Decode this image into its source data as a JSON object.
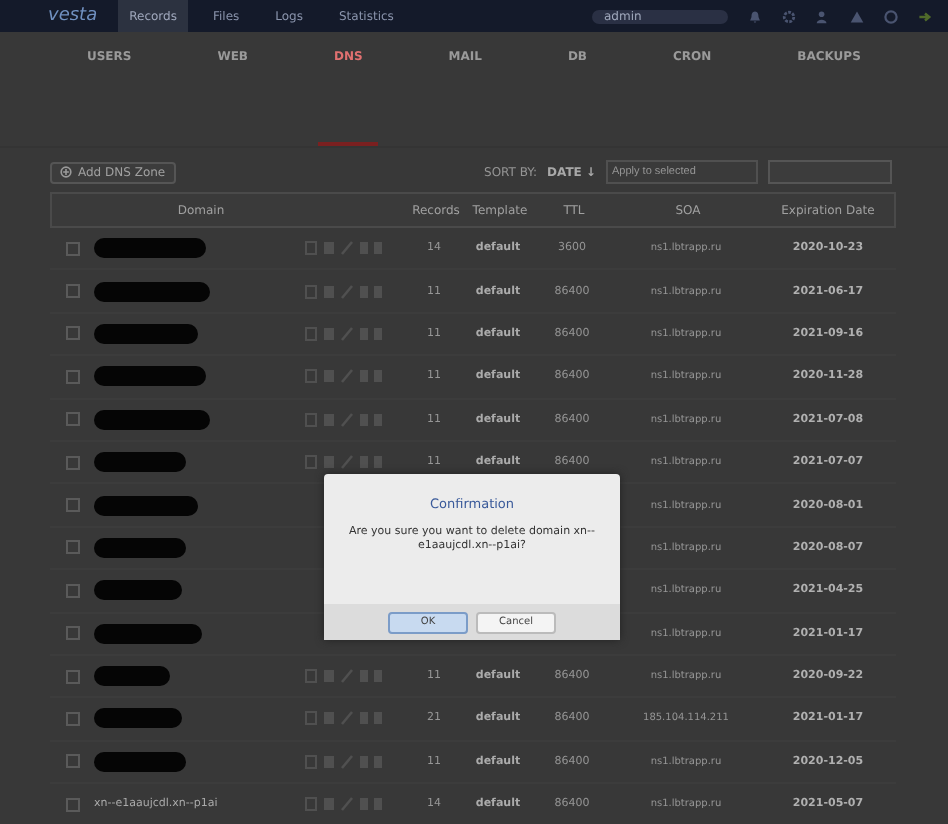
{
  "topbar": {
    "logo": "vesta",
    "nav": [
      {
        "label": "Records",
        "selected": true
      },
      {
        "label": "Files",
        "selected": false
      },
      {
        "label": "Logs",
        "selected": false
      },
      {
        "label": "Statistics",
        "selected": false
      }
    ],
    "user": "admin"
  },
  "sections": [
    {
      "label": "USERS",
      "selected": false
    },
    {
      "label": "WEB",
      "selected": false
    },
    {
      "label": "DNS",
      "selected": true
    },
    {
      "label": "MAIL",
      "selected": false
    },
    {
      "label": "DB",
      "selected": false
    },
    {
      "label": "CRON",
      "selected": false
    },
    {
      "label": "BACKUPS",
      "selected": false
    }
  ],
  "toolbar": {
    "add_button": "Add DNS Zone",
    "sort_label": "SORT BY:",
    "sort_value": "DATE ↓",
    "bulk_placeholder": "Apply to selected"
  },
  "table": {
    "columns": [
      "Domain",
      "Records",
      "Template",
      "TTL",
      "SOA",
      "Expiration Date"
    ],
    "rows": [
      {
        "checked": false,
        "records": "14",
        "template": "default",
        "ttl": "3600",
        "soa": "ns1.lbtrapp.ru",
        "date": "2020-10-23"
      },
      {
        "checked": false,
        "records": "11",
        "template": "default",
        "ttl": "86400",
        "soa": "ns1.lbtrapp.ru",
        "date": "2021-06-17"
      },
      {
        "checked": false,
        "records": "11",
        "template": "default",
        "ttl": "86400",
        "soa": "ns1.lbtrapp.ru",
        "date": "2021-09-16"
      },
      {
        "checked": false,
        "records": "11",
        "template": "default",
        "ttl": "86400",
        "soa": "ns1.lbtrapp.ru",
        "date": "2020-11-28"
      },
      {
        "checked": false,
        "records": "11",
        "template": "default",
        "ttl": "86400",
        "soa": "ns1.lbtrapp.ru",
        "date": "2021-07-08"
      },
      {
        "checked": false,
        "records": "11",
        "template": "default",
        "ttl": "86400",
        "soa": "ns1.lbtrapp.ru",
        "date": "2021-07-07"
      },
      {
        "checked": false,
        "soa": "ns1.lbtrapp.ru",
        "date": "2020-08-01"
      },
      {
        "checked": false,
        "soa": "ns1.lbtrapp.ru",
        "date": "2020-08-07"
      },
      {
        "checked": false,
        "soa": "ns1.lbtrapp.ru",
        "date": "2021-04-25"
      },
      {
        "checked": false,
        "soa": "ns1.lbtrapp.ru",
        "date": "2021-01-17"
      },
      {
        "checked": false,
        "records": "11",
        "template": "default",
        "ttl": "86400",
        "soa": "ns1.lbtrapp.ru",
        "date": "2020-09-22"
      },
      {
        "checked": false,
        "records": "21",
        "template": "default",
        "ttl": "86400",
        "soa": "185.104.114.211",
        "date": "2021-01-17"
      },
      {
        "checked": false,
        "records": "11",
        "template": "default",
        "ttl": "86400",
        "soa": "ns1.lbtrapp.ru",
        "date": "2020-12-05"
      },
      {
        "checked": false,
        "domain": "xn--e1aaujcdl.xn--p1ai",
        "records": "14",
        "template": "default",
        "ttl": "86400",
        "soa": "ns1.lbtrapp.ru",
        "date": "2021-05-07"
      }
    ]
  },
  "dialog": {
    "title": "Confirmation",
    "message": "Are you sure you want to delete domain xn--e1aaujcdl.xn--p1ai?",
    "buttons": [
      {
        "label": "OK",
        "selected": true
      },
      {
        "label": "Cancel",
        "selected": false
      }
    ]
  }
}
